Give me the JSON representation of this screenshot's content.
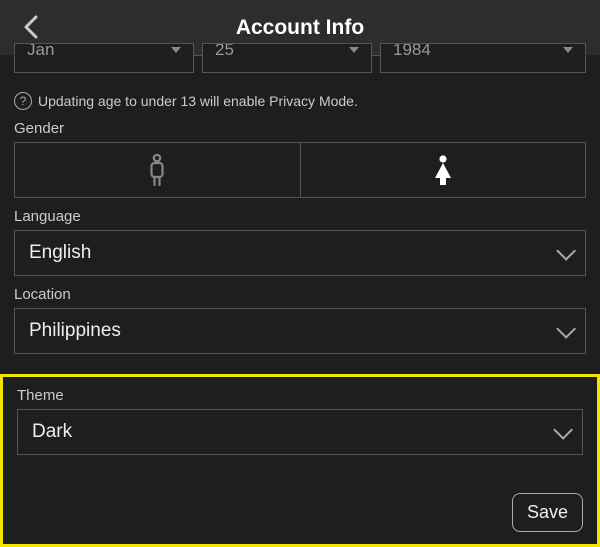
{
  "header": {
    "title": "Account Info"
  },
  "dob": {
    "month": "Jan",
    "day": "25",
    "year": "1984"
  },
  "privacy_note": "Updating age to under 13 will enable Privacy Mode.",
  "labels": {
    "gender": "Gender",
    "language": "Language",
    "location": "Location",
    "theme": "Theme"
  },
  "language": {
    "value": "English"
  },
  "location": {
    "value": "Philippines"
  },
  "theme": {
    "value": "Dark"
  },
  "buttons": {
    "save": "Save"
  }
}
